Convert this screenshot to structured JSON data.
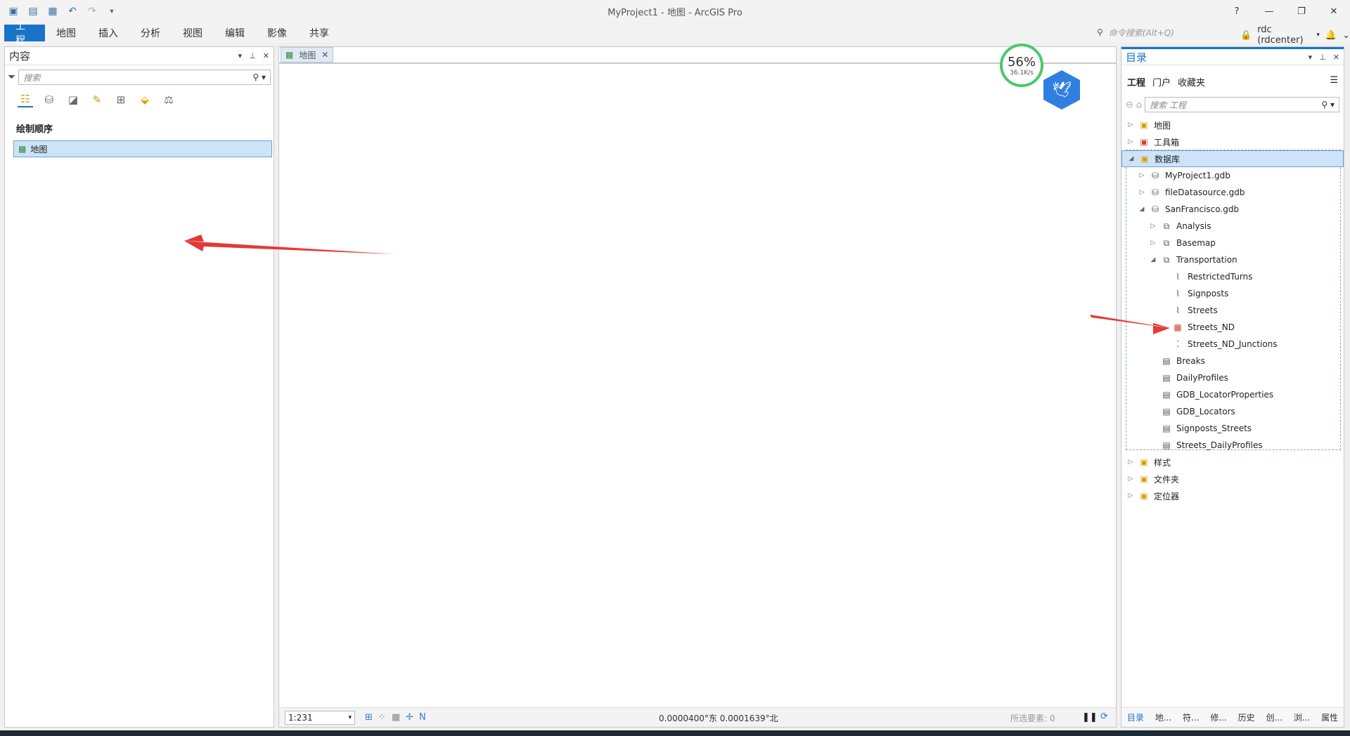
{
  "window": {
    "title": "MyProject1 - 地图 - ArcGIS Pro",
    "help": "?"
  },
  "menu": {
    "tabs": [
      "工程",
      "地图",
      "插入",
      "分析",
      "视图",
      "编辑",
      "影像",
      "共享"
    ]
  },
  "command_search": {
    "placeholder": "命令搜索(Alt+Q)"
  },
  "user": {
    "label": "rdc (rdcenter)"
  },
  "contents": {
    "title": "内容",
    "search_placeholder": "搜索",
    "section": "绘制顺序",
    "map_item": "地图"
  },
  "map_view": {
    "tab_label": "地图",
    "scale": "1:231",
    "coordinates": "0.0000400°东 0.0001639°北",
    "selected": "所选要素: 0"
  },
  "overlay": {
    "percent": "56%",
    "speed": "36.1K/s"
  },
  "catalog": {
    "title": "目录",
    "tabs": [
      "工程",
      "门户",
      "收藏夹"
    ],
    "search_placeholder": "搜索 工程",
    "tree": [
      {
        "label": "地图",
        "level": 0,
        "exp": "▷",
        "icon": "map-folder-icon"
      },
      {
        "label": "工具箱",
        "level": 0,
        "exp": "▷",
        "icon": "toolbox-folder-icon"
      },
      {
        "label": "数据库",
        "level": 0,
        "exp": "◢",
        "icon": "database-folder-icon",
        "hl": true
      },
      {
        "label": "MyProject1.gdb",
        "level": 1,
        "exp": "▷",
        "icon": "gdb-icon"
      },
      {
        "label": "fileDatasource.gdb",
        "level": 1,
        "exp": "▷",
        "icon": "gdb-icon"
      },
      {
        "label": "SanFrancisco.gdb",
        "level": 1,
        "exp": "◢",
        "icon": "gdb-icon"
      },
      {
        "label": "Analysis",
        "level": 2,
        "exp": "▷",
        "icon": "dataset-icon"
      },
      {
        "label": "Basemap",
        "level": 2,
        "exp": "▷",
        "icon": "dataset-icon"
      },
      {
        "label": "Transportation",
        "level": 2,
        "exp": "◢",
        "icon": "dataset-icon"
      },
      {
        "label": "RestrictedTurns",
        "level": 3,
        "exp": "",
        "icon": "line-fc-icon"
      },
      {
        "label": "Signposts",
        "level": 3,
        "exp": "",
        "icon": "line-fc-icon"
      },
      {
        "label": "Streets",
        "level": 3,
        "exp": "",
        "icon": "line-fc-icon"
      },
      {
        "label": "Streets_ND",
        "level": 3,
        "exp": "",
        "icon": "network-dataset-icon"
      },
      {
        "label": "Streets_ND_Junctions",
        "level": 3,
        "exp": "",
        "icon": "point-fc-icon"
      },
      {
        "label": "Breaks",
        "level": 2,
        "exp": "",
        "icon": "table-icon"
      },
      {
        "label": "DailyProfiles",
        "level": 2,
        "exp": "",
        "icon": "table-icon"
      },
      {
        "label": "GDB_LocatorProperties",
        "level": 2,
        "exp": "",
        "icon": "table-icon"
      },
      {
        "label": "GDB_Locators",
        "level": 2,
        "exp": "",
        "icon": "table-icon"
      },
      {
        "label": "Signposts_Streets",
        "level": 2,
        "exp": "",
        "icon": "table-icon"
      },
      {
        "label": "Streets_DailyProfiles",
        "level": 2,
        "exp": "",
        "icon": "table-icon"
      },
      {
        "label": "样式",
        "level": 0,
        "exp": "▷",
        "icon": "style-folder-icon"
      },
      {
        "label": "文件夹",
        "level": 0,
        "exp": "▷",
        "icon": "folder-icon"
      },
      {
        "label": "定位器",
        "level": 0,
        "exp": "▷",
        "icon": "locator-folder-icon"
      }
    ],
    "footer_tabs": [
      "目录",
      "地...",
      "符...",
      "修...",
      "历史",
      "创...",
      "浏...",
      "属性"
    ]
  }
}
